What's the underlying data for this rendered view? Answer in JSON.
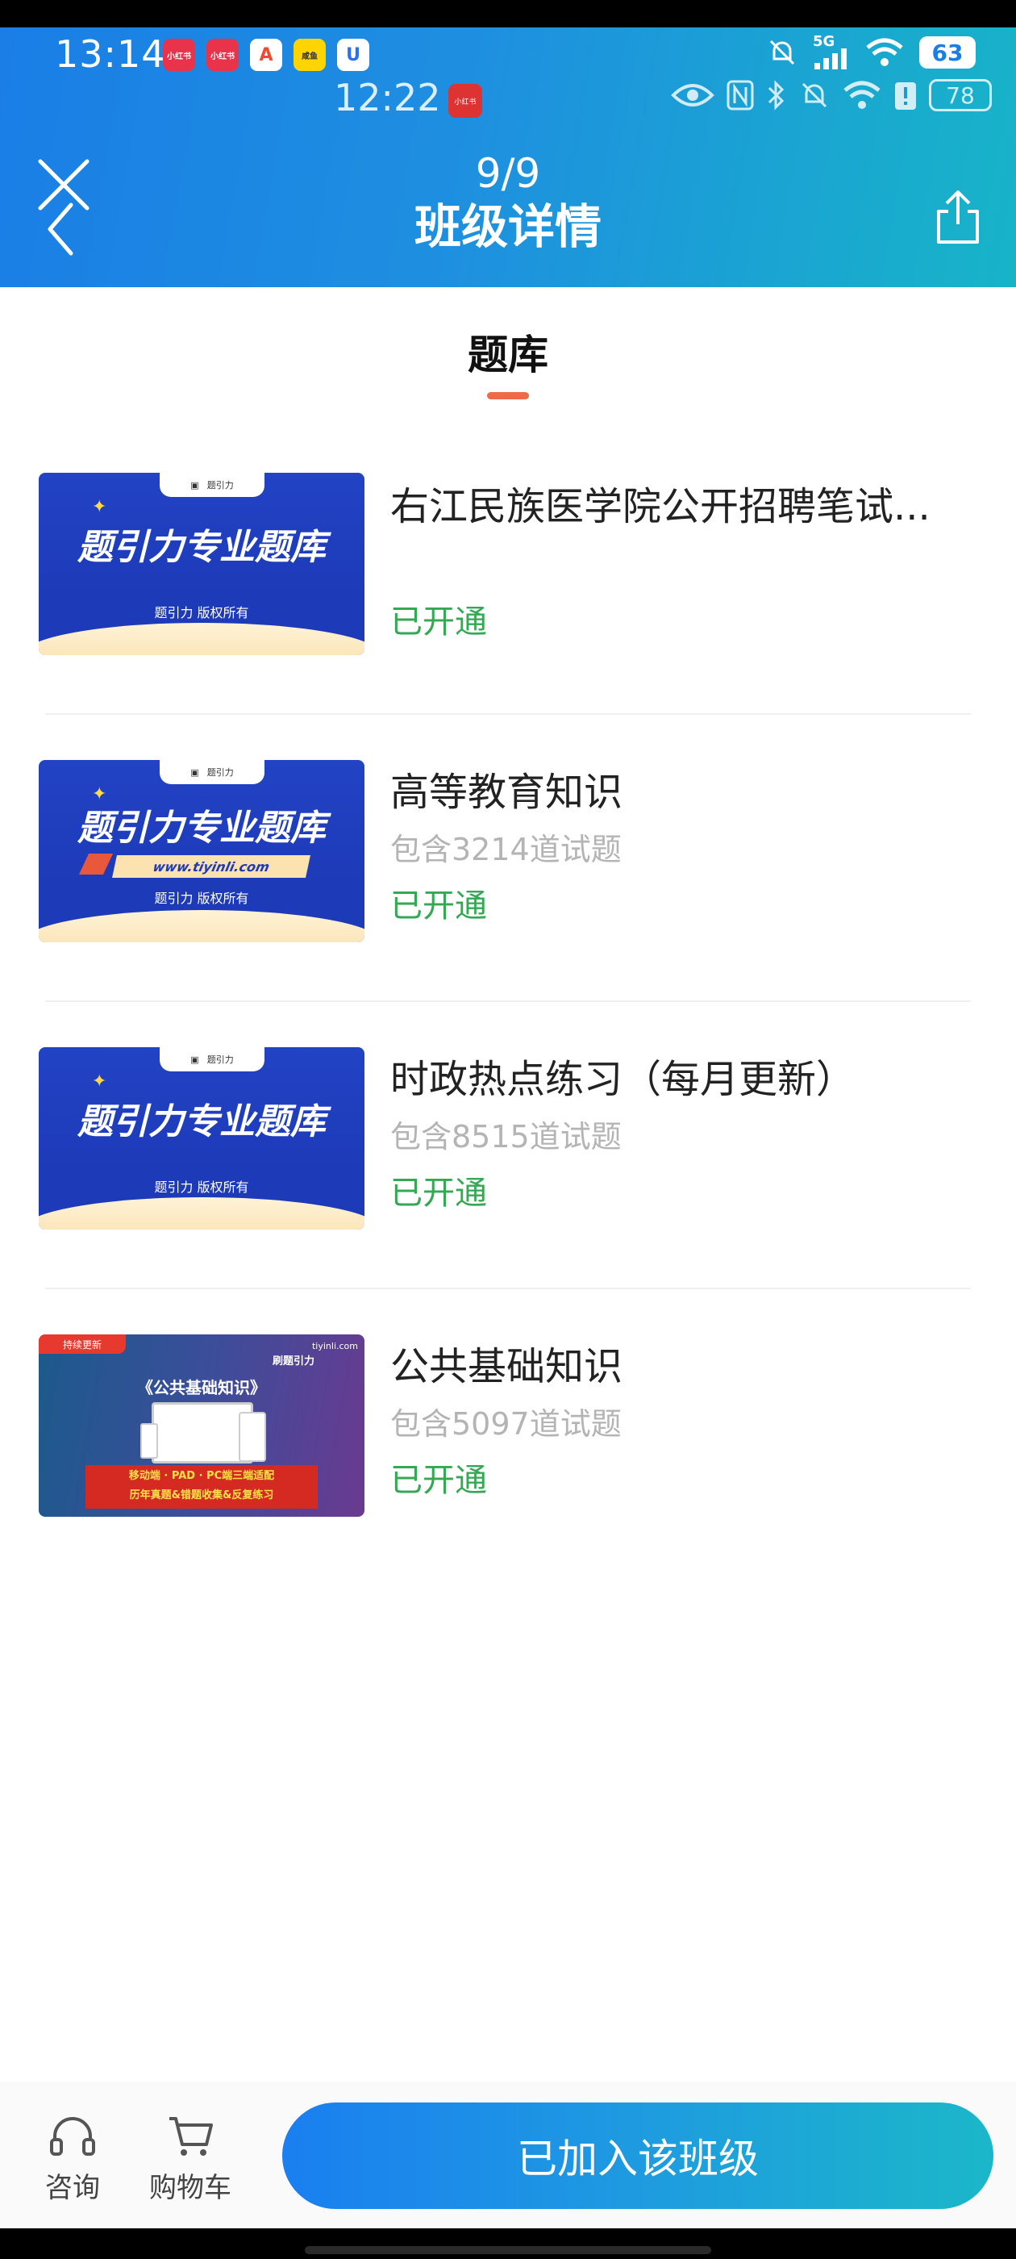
{
  "status_bar": {
    "time": "13:14",
    "apps": [
      {
        "label": "小红书",
        "color": "#e8334a"
      },
      {
        "label": "小红书",
        "color": "#e8334a"
      },
      {
        "label": "A",
        "color": "#f24a2f"
      },
      {
        "label": "咸鱼",
        "color": "#ffd400"
      },
      {
        "label": "U",
        "color": "#2a6ff2"
      }
    ],
    "network": "5G",
    "battery": "63"
  },
  "overlay_status_bar": {
    "time": "12:22",
    "app_label": "小红书",
    "battery": "78"
  },
  "header": {
    "counter": "9/9",
    "title": "班级详情"
  },
  "section": {
    "tab_label": "题库"
  },
  "items": [
    {
      "title": "右江民族医学院公开招聘笔试...",
      "subtitle": "",
      "status": "已开通",
      "thumb": {
        "type": "blue",
        "title": "题引力专业题库",
        "copyright": "题引力 版权所有",
        "badge": "题引力"
      }
    },
    {
      "title": "高等教育知识",
      "subtitle": "包含3214道试题",
      "status": "已开通",
      "thumb": {
        "type": "blue-url",
        "title": "题引力专业题库",
        "copyright": "题引力 版权所有",
        "badge": "题引力",
        "url": "www.tiyinli.com"
      }
    },
    {
      "title": "时政热点练习（每月更新）",
      "subtitle": "包含8515道试题",
      "status": "已开通",
      "thumb": {
        "type": "blue",
        "title": "题引力专业题库",
        "copyright": "题引力 版权所有",
        "badge": "题引力"
      }
    },
    {
      "title": "公共基础知识",
      "subtitle": "包含5097道试题",
      "status": "已开通",
      "thumb": {
        "type": "purple",
        "tag": "持续更新",
        "logo": "刷题引力",
        "url": "tiyinli.com",
        "title": "《公共基础知识》",
        "band_line1": "移动端 · PAD · PC端三端适配",
        "band_line2": "历年真题&错题收集&反复练习"
      }
    }
  ],
  "bottom_bar": {
    "consult_label": "咨询",
    "cart_label": "购物车",
    "join_label": "已加入该班级"
  },
  "colors": {
    "header_start": "#1a7ee6",
    "header_end": "#17b4c8",
    "status_green": "#34a853",
    "tab_indicator": "#ee6a4b"
  }
}
